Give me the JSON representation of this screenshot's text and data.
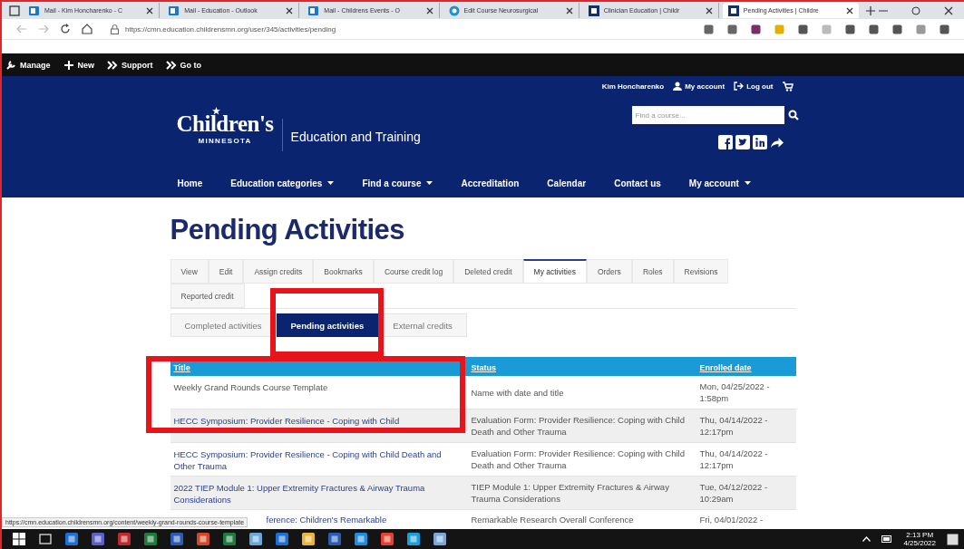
{
  "browser": {
    "tabs": [
      {
        "title": "Mail - Kim Honcharenko - C",
        "kind": "mail",
        "selected": false
      },
      {
        "title": "Mail - Education - Outlook",
        "kind": "mail",
        "selected": false
      },
      {
        "title": "Mail - Childrens Events - O",
        "kind": "mail",
        "selected": false
      },
      {
        "title": "Edit Course Neurosurgical",
        "kind": "edge",
        "selected": false
      },
      {
        "title": "Clinician Education | Childr",
        "kind": "site",
        "selected": false
      },
      {
        "title": "Pending Activities | Childre",
        "kind": "site",
        "selected": true
      }
    ],
    "url": "https://cmn.education.childrensmn.org/user/345/activities/pending"
  },
  "admin_toolbar": [
    {
      "label": "Manage",
      "kind": "wrench"
    },
    {
      "label": "New",
      "kind": "plus"
    },
    {
      "label": "Support",
      "kind": "chevrons"
    },
    {
      "label": "Go to",
      "kind": "chevrons"
    }
  ],
  "header": {
    "user_name": "Kim Honcharenko",
    "account_link": "My account",
    "logout_link": "Log out",
    "logo_name": "Children's",
    "logo_sub": "MINNESOTA",
    "site_title": "Education and Training",
    "search": {
      "placeholder": "Find a course..."
    }
  },
  "nav": [
    {
      "label": "Home",
      "dropdown": false
    },
    {
      "label": "Education categories",
      "dropdown": true
    },
    {
      "label": "Find a course",
      "dropdown": true
    },
    {
      "label": "Accreditation",
      "dropdown": false
    },
    {
      "label": "Calendar",
      "dropdown": false
    },
    {
      "label": "Contact us",
      "dropdown": false
    },
    {
      "label": "My account",
      "dropdown": true
    }
  ],
  "page_title": "Pending Activities",
  "tabs": [
    {
      "label": "View",
      "selected": false
    },
    {
      "label": "Edit",
      "selected": false
    },
    {
      "label": "Assign credits",
      "selected": false
    },
    {
      "label": "Bookmarks",
      "selected": false
    },
    {
      "label": "Course credit log",
      "selected": false
    },
    {
      "label": "Deleted credit",
      "selected": false
    },
    {
      "label": "My activities",
      "selected": true
    },
    {
      "label": "Orders",
      "selected": false
    },
    {
      "label": "Roles",
      "selected": false
    },
    {
      "label": "Revisions",
      "selected": false
    },
    {
      "label": "Reported credit",
      "selected": false
    }
  ],
  "subtabs": [
    {
      "label": "Completed activities",
      "selected": false
    },
    {
      "label": "Pending activities",
      "selected": true
    },
    {
      "label": "External credits",
      "selected": false
    }
  ],
  "table": {
    "columns": [
      "Title",
      "Status",
      "Enrolled date"
    ],
    "rows": [
      {
        "title": "Weekly Grand Rounds Course Template",
        "status": "Name with date and title",
        "enrolled": "Mon, 04/25/2022 - 1:58pm",
        "hovered": true
      },
      {
        "title": "HECC Symposium: Provider Resilience - Coping with Child",
        "status": "Evaluation Form: Provider Resilience: Coping with Child Death and Other Trauma",
        "enrolled": "Thu, 04/14/2022 - 12:17pm",
        "hovered": false
      },
      {
        "title": "HECC Symposium: Provider Resilience - Coping with Child Death and Other Trauma",
        "status": "Evaluation Form: Provider Resilience: Coping with Child Death and Other Trauma",
        "enrolled": "Thu, 04/14/2022 - 12:17pm",
        "hovered": false
      },
      {
        "title": "2022 TIEP Module 1: Upper Extremity Fractures & Airway Trauma Considerations",
        "status": "TIEP Module 1: Upper Extremity Fractures & Airway Trauma Considerations",
        "enrolled": "Tue, 04/12/2022 - 10:29am",
        "hovered": false
      },
      {
        "title": "ference: Children's Remarkable",
        "status": "Remarkable Research Overall Conference",
        "enrolled": "Fri, 04/01/2022 -",
        "hovered": false,
        "partial": true
      }
    ]
  },
  "status_url": "https://cmn.education.childrensmn.org/content/weekly-grand-rounds-course-template",
  "taskbar": {
    "time": "2:13 PM",
    "date": "4/25/2022"
  }
}
